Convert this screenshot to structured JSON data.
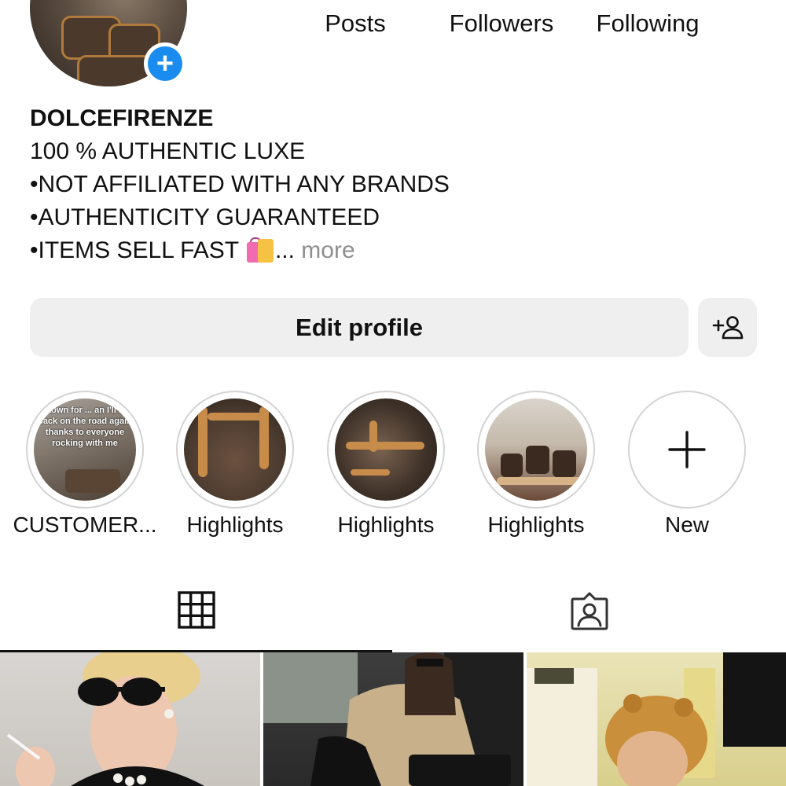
{
  "profile": {
    "avatar_alt": "profile photo",
    "stats": [
      {
        "value": "",
        "label": "Posts"
      },
      {
        "value": "",
        "label": "Followers"
      },
      {
        "value": "",
        "label": "Following"
      }
    ]
  },
  "bio": {
    "name": "DOLCEFIRENZE",
    "line1": "100 % AUTHENTIC LUXE",
    "line2": "•NOT AFFILIATED WITH ANY BRANDS",
    "line3": "•AUTHENTICITY GUARANTEED",
    "line4": "•ITEMS SELL FAST",
    "ellipsis": "...",
    "more": "more"
  },
  "buttons": {
    "edit_profile": "Edit profile"
  },
  "highlights": [
    {
      "label": "CUSTOMER...",
      "overlay_text": "...town for ... an I'll be back on the road again thanks to everyone rocking with me"
    },
    {
      "label": "Highlights"
    },
    {
      "label": "Highlights"
    },
    {
      "label": "Highlights"
    },
    {
      "label": "New"
    }
  ],
  "tabs": {
    "grid": "grid-icon",
    "tagged": "tagged-person-icon"
  },
  "colors": {
    "accent_blue": "#1a8cf0",
    "button_bg": "#efefef",
    "muted_text": "#8e8e8e"
  }
}
